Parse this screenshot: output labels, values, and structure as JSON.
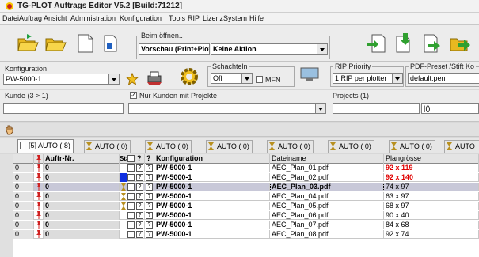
{
  "window": {
    "title": "TG-PLOT Auftrags Editor  V5.2  [Build:71212]"
  },
  "menu": [
    "Datei",
    "Auftrag",
    "Ansicht",
    "Administration",
    "Konfiguration",
    "Tools",
    "RIP",
    "Lizenz",
    "System",
    "Hilfe"
  ],
  "toolbar": {
    "beim_oeffnen_label": "Beim öffnen..",
    "beim_oeffnen_value1": "Vorschau (Print+Plots",
    "beim_oeffnen_value2": "Keine Aktion"
  },
  "config_bar": {
    "konfiguration_label": "Konfiguration",
    "konfiguration_value": "PW-5000-1",
    "schachteln_label": "Schachteln",
    "schachteln_value": "Off",
    "mfn_label": "MFN",
    "rip_priority_label": "RIP Priority",
    "rip_priority_value": "1 RIP per plotter",
    "pdf_preset_label": "PDF-Preset /Stift Ko",
    "pdf_preset_value": "default.pen"
  },
  "filter_bar": {
    "kunde_label": "Kunde (3 > 1)",
    "nur_kunden_label": "Nur Kunden mit Projekte",
    "nur_kunden_checked": "✓",
    "projects_label": "Projects (1)",
    "projects_value": "|()"
  },
  "tabs": [
    {
      "label": "[5] AUTO (  8)"
    },
    {
      "label": "AUTO (  0)"
    },
    {
      "label": "AUTO (  0)"
    },
    {
      "label": "AUTO (  0)"
    },
    {
      "label": "AUTO (  0)"
    },
    {
      "label": "AUTO (  0)"
    },
    {
      "label": "AUTO (  0)"
    },
    {
      "label": "AUTO"
    }
  ],
  "table": {
    "headers": {
      "auftr": "Auftr-Nr.",
      "sta": "Sta",
      "q1": "?",
      "q2": "?",
      "konfig": "Konfiguration",
      "datei": "Dateiname",
      "groesse": "Plangrösse"
    },
    "rows": [
      {
        "rownum": "0",
        "auftr": "0",
        "konfig": "PW-5000-1",
        "datei": "AEC_Plan_01.pdf",
        "groesse": "92 x 119"
      },
      {
        "rownum": "0",
        "auftr": "0",
        "konfig": "PW-5000-1",
        "datei": "AEC_Plan_02.pdf",
        "groesse": "92 x 140"
      },
      {
        "rownum": "0",
        "auftr": "0",
        "konfig": "PW-5000-1",
        "datei": "AEC_Plan_03.pdf",
        "groesse": "74 x 97"
      },
      {
        "rownum": "0",
        "auftr": "0",
        "konfig": "PW-5000-1",
        "datei": "AEC_Plan_04.pdf",
        "groesse": "63 x 97"
      },
      {
        "rownum": "0",
        "auftr": "0",
        "konfig": "PW-5000-1",
        "datei": "AEC_Plan_05.pdf",
        "groesse": "68 x 97"
      },
      {
        "rownum": "0",
        "auftr": "0",
        "konfig": "PW-5000-1",
        "datei": "AEC_Plan_06.pdf",
        "groesse": "90 x 40"
      },
      {
        "rownum": "0",
        "auftr": "0",
        "konfig": "PW-5000-1",
        "datei": "AEC_Plan_07.pdf",
        "groesse": "84 x 68"
      },
      {
        "rownum": "0",
        "auftr": "0",
        "konfig": "PW-5000-1",
        "datei": "AEC_Plan_08.pdf",
        "groesse": "92 x 74"
      }
    ]
  },
  "colors": {
    "oversize": "#e00000",
    "selected_row": "#c8c8d8",
    "blue_marker": "#1030e0",
    "hourglass": "#b89020",
    "pin_red": "#d02020"
  }
}
